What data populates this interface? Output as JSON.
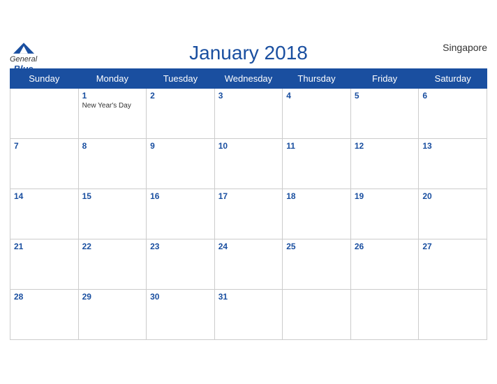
{
  "header": {
    "title": "January 2018",
    "country": "Singapore",
    "logo": {
      "general": "General",
      "blue": "Blue"
    }
  },
  "weekdays": [
    "Sunday",
    "Monday",
    "Tuesday",
    "Wednesday",
    "Thursday",
    "Friday",
    "Saturday"
  ],
  "weeks": [
    [
      {
        "date": "",
        "empty": true
      },
      {
        "date": "1",
        "holiday": "New Year's Day"
      },
      {
        "date": "2"
      },
      {
        "date": "3"
      },
      {
        "date": "4"
      },
      {
        "date": "5"
      },
      {
        "date": "6"
      }
    ],
    [
      {
        "date": "7"
      },
      {
        "date": "8"
      },
      {
        "date": "9"
      },
      {
        "date": "10"
      },
      {
        "date": "11"
      },
      {
        "date": "12"
      },
      {
        "date": "13"
      }
    ],
    [
      {
        "date": "14"
      },
      {
        "date": "15"
      },
      {
        "date": "16"
      },
      {
        "date": "17"
      },
      {
        "date": "18"
      },
      {
        "date": "19"
      },
      {
        "date": "20"
      }
    ],
    [
      {
        "date": "21"
      },
      {
        "date": "22"
      },
      {
        "date": "23"
      },
      {
        "date": "24"
      },
      {
        "date": "25"
      },
      {
        "date": "26"
      },
      {
        "date": "27"
      }
    ],
    [
      {
        "date": "28"
      },
      {
        "date": "29"
      },
      {
        "date": "30"
      },
      {
        "date": "31"
      },
      {
        "date": ""
      },
      {
        "date": ""
      },
      {
        "date": ""
      }
    ]
  ],
  "accent_color": "#1a4fa0"
}
